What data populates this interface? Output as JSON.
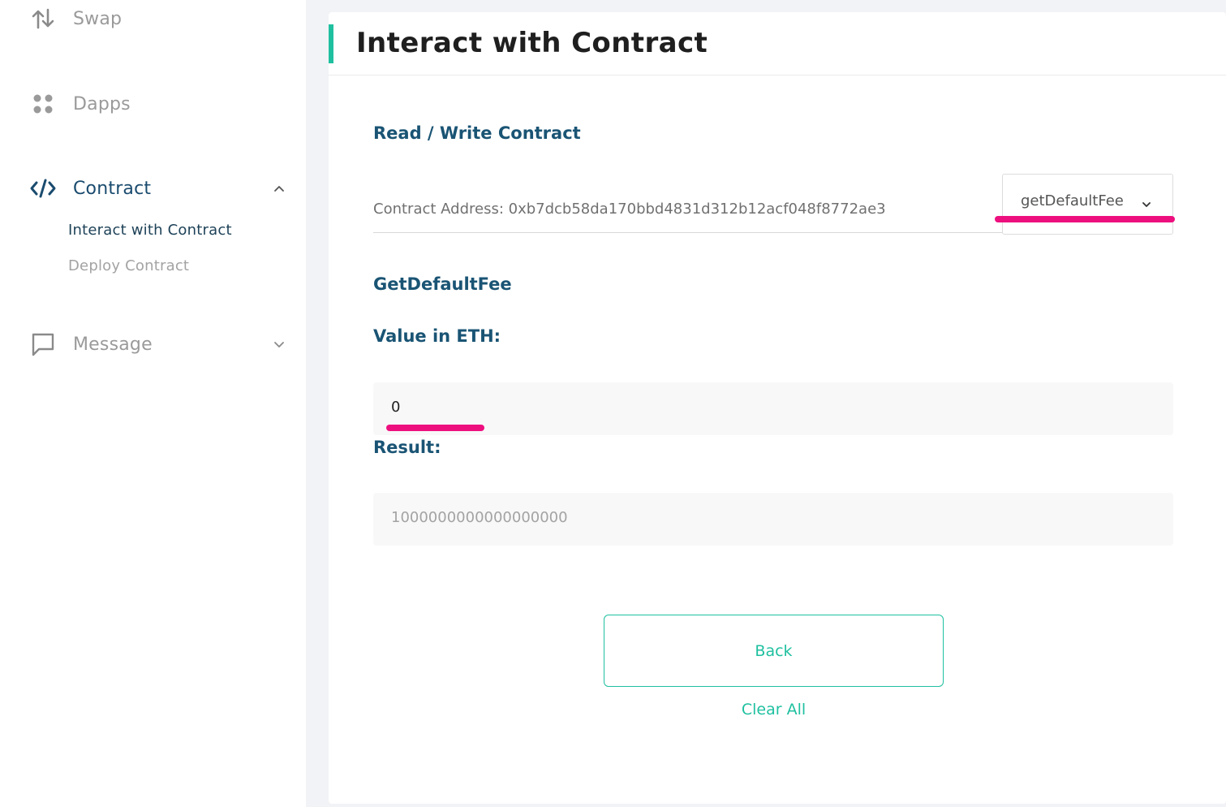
{
  "sidebar": {
    "items": [
      {
        "label": "Swap",
        "icon": "swap-arrows-icon"
      },
      {
        "label": "Dapps",
        "icon": "dapps-grid-icon"
      },
      {
        "label": "Contract",
        "icon": "code-icon",
        "expanded": true,
        "subitems": [
          {
            "label": "Interact with Contract",
            "active": true
          },
          {
            "label": "Deploy Contract",
            "active": false
          }
        ]
      },
      {
        "label": "Message",
        "icon": "message-bubble-icon",
        "expanded": false
      }
    ]
  },
  "main": {
    "title": "Interact with Contract",
    "section_title": "Read / Write Contract",
    "contract_address_text": "Contract Address: 0xb7dcb58da170bbd4831d312b12acf048f8772ae3",
    "method_select": {
      "selected": "getDefaultFee"
    },
    "method_name": "GetDefaultFee",
    "value_label": "Value in ETH:",
    "value_input": "0",
    "result_label": "Result:",
    "result_value": "1000000000000000000",
    "back_button": "Back",
    "clear_all": "Clear All"
  },
  "colors": {
    "accent": "#1fc0a0",
    "heading": "#1a5474",
    "highlight": "#ee0f7f",
    "sidebar_active": "#1a4b6e",
    "sidebar_inactive": "#9a9a9a"
  }
}
